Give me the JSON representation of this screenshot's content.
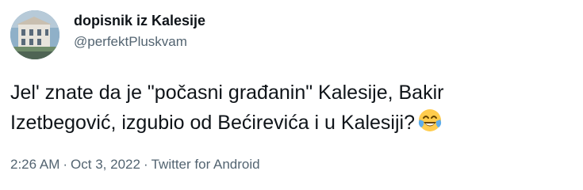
{
  "user": {
    "display_name": "dopisnik iz Kalesije",
    "handle": "@perfektPluskvam"
  },
  "tweet": {
    "line1": "Jel' znate da je \"počasni građanin\" Kalesije, Bakir",
    "line2": "Izetbegović, izgubio od Bećirevića i u Kalesiji?",
    "emoji": "face-with-tears-of-joy-icon"
  },
  "meta": {
    "time": "2:26 AM",
    "separator": "·",
    "date": "Oct 3, 2022",
    "source": "Twitter for Android"
  },
  "colors": {
    "text": "#0f1419",
    "secondary": "#536471"
  }
}
